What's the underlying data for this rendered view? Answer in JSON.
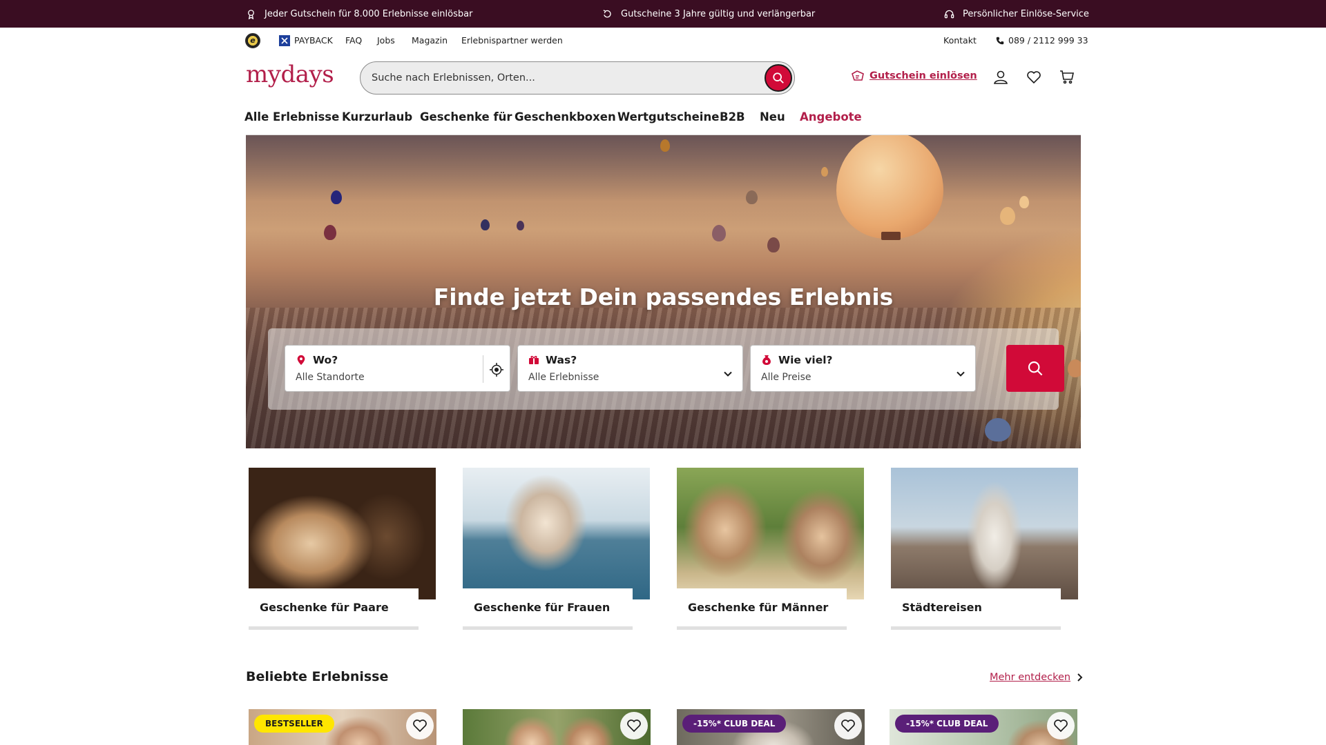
{
  "promo_bar": {
    "items": [
      {
        "icon": "gift-icon",
        "text": "Jeder Gutschein für 8.000 Erlebnisse einlösbar"
      },
      {
        "icon": "refresh-icon",
        "text": "Gutscheine 3 Jahre gültig und verlängerbar"
      },
      {
        "icon": "headset-icon",
        "text": "Persönlicher Einlöse-Service"
      }
    ]
  },
  "utility_bar": {
    "left": [
      {
        "text": "PAYBACK"
      },
      {
        "text": "FAQ"
      },
      {
        "text": "Jobs"
      },
      {
        "text": "Magazin"
      },
      {
        "text": "Erlebnispartner werden"
      }
    ],
    "contact": "Kontakt",
    "phone": "089 / 2112 999 33"
  },
  "header": {
    "logo": "mydays",
    "search_placeholder": "Suche nach Erlebnissen, Orten...",
    "redeem_label": "Gutschein einlösen"
  },
  "nav": {
    "items": [
      {
        "label": "Alle Erlebnisse"
      },
      {
        "label": "Kurzurlaub"
      },
      {
        "label": "Geschenke für"
      },
      {
        "label": "Geschenkboxen"
      },
      {
        "label": "Wertgutscheine"
      },
      {
        "label": "B2B"
      },
      {
        "label": "Neu"
      },
      {
        "label": "Angebote"
      }
    ]
  },
  "hero": {
    "title": "Finde jetzt Dein passendes Erlebnis",
    "where_label": "Wo?",
    "where_value": "Alle Standorte",
    "what_label": "Was?",
    "what_value": "Alle Erlebnisse",
    "price_label": "Wie viel?",
    "price_value": "Alle Preise"
  },
  "categories": [
    {
      "label": "Geschenke für Paare"
    },
    {
      "label": "Geschenke für Frauen"
    },
    {
      "label": "Geschenke für Männer"
    },
    {
      "label": "Städtereisen"
    }
  ],
  "popular": {
    "title": "Beliebte Erlebnisse",
    "more_label": "Mehr entdecken",
    "products": [
      {
        "badge": "BESTSELLER"
      },
      {
        "badge": ""
      },
      {
        "badge": "-15%* CLUB DEAL"
      },
      {
        "badge": "-15%* CLUB DEAL"
      }
    ]
  },
  "colors": {
    "brand": "#b21f4a",
    "cta": "#d10a38",
    "promo_bg": "#3a0d22",
    "club_badge": "#5a1f78",
    "bestseller_badge": "#ffe600"
  }
}
